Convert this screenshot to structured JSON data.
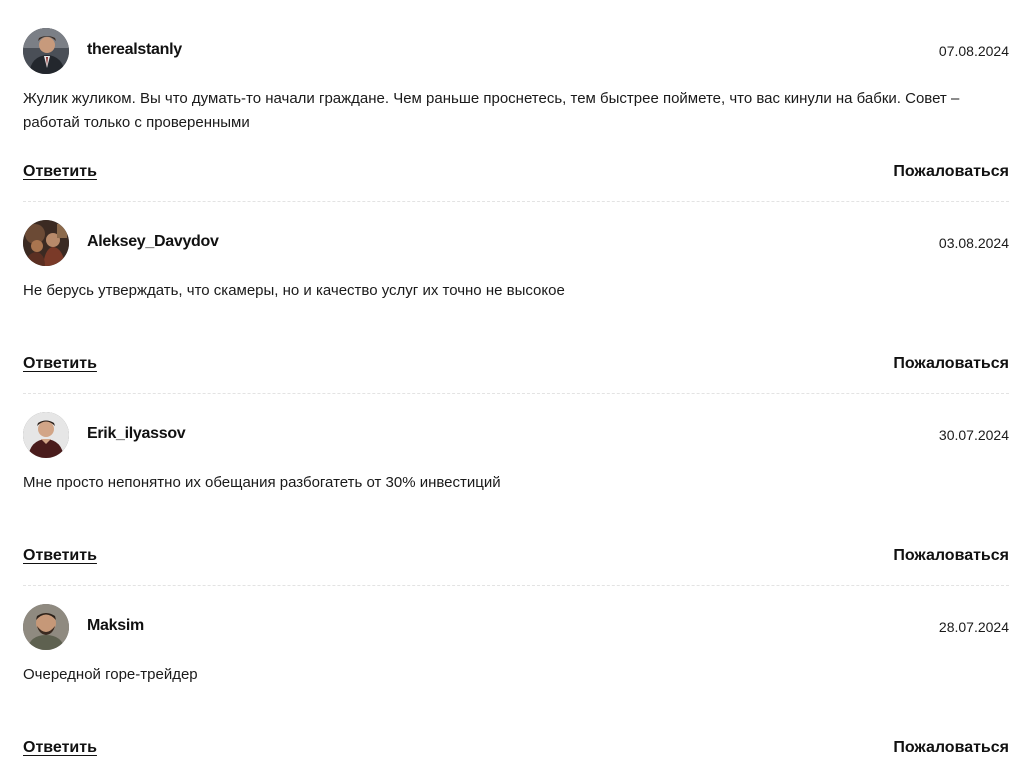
{
  "comments": [
    {
      "username": "therealstanly",
      "date": "07.08.2024",
      "text": "Жулик жуликом. Вы что думать-то начали граждане. Чем раньше проснетесь, тем быстрее поймете, что вас кинули на бабки. Совет – работай только с проверенными",
      "reply_label": "Ответить",
      "report_label": "Пожаловаться",
      "avatar_icon": "user-avatar-photo"
    },
    {
      "username": "Aleksey_Davydov",
      "date": "03.08.2024",
      "text": "Не берусь утверждать, что скамеры, но и качество услуг их точно не высокое",
      "reply_label": "Ответить",
      "report_label": "Пожаловаться",
      "avatar_icon": "user-avatar-photo"
    },
    {
      "username": "Erik_ilyassov",
      "date": "30.07.2024",
      "text": "Мне просто непонятно их обещания разбогатеть от 30% инвестиций",
      "reply_label": "Ответить",
      "report_label": "Пожаловаться",
      "avatar_icon": "user-avatar-photo"
    },
    {
      "username": "Maksim",
      "date": "28.07.2024",
      "text": "Очередной горе-трейдер",
      "reply_label": "Ответить",
      "report_label": "Пожаловаться",
      "avatar_icon": "user-avatar-photo"
    }
  ],
  "colors": {
    "text": "#1a1a1a",
    "separator": "#e3e3e3",
    "background": "#ffffff"
  }
}
